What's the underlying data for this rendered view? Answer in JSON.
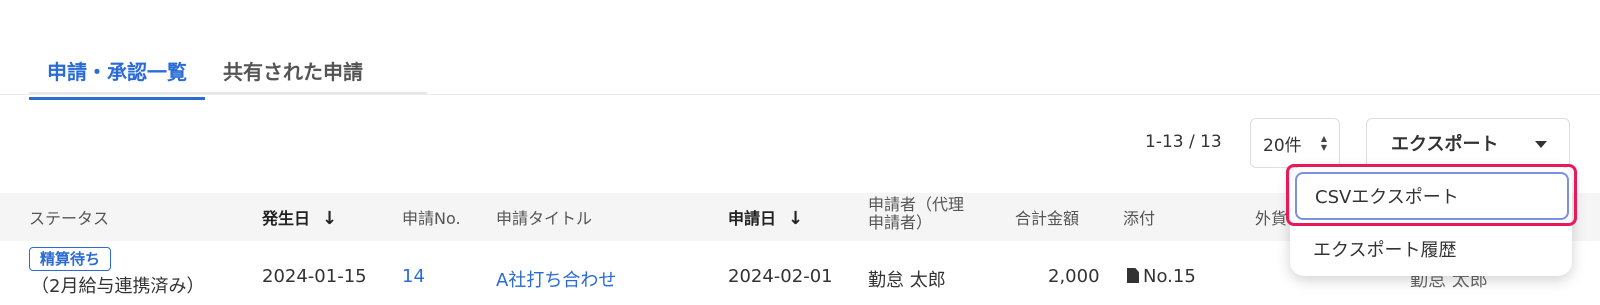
{
  "tabs": [
    {
      "label": "申請・承認一覧",
      "active": true
    },
    {
      "label": "共有された申請",
      "active": false
    }
  ],
  "toolbar": {
    "count": "1-13 / 13",
    "per_page": "20件",
    "export_label": "エクスポート"
  },
  "export_menu": {
    "items": [
      "CSVエクスポート",
      "エクスポート履歴"
    ]
  },
  "table": {
    "headers": [
      "ステータス",
      "発生日",
      "申請No.",
      "申請タイトル",
      "申請日",
      "申請者（代理",
      "申請者）",
      "合計金額",
      "添付",
      "外貨"
    ],
    "row": {
      "status_badge": "精算待ち",
      "status_note": "（2月給与連携済み）",
      "date": "2024-01-15",
      "no": "14",
      "title": "A社打ち合わせ",
      "apply_date": "2024-02-01",
      "applicant": "勤怠 太郎",
      "amount": "2,000",
      "attachment": "No.15",
      "right_partial": "勤怠 太郎"
    }
  },
  "colors": {
    "accent": "#2a6bd6",
    "highlight": "#e8195a"
  }
}
